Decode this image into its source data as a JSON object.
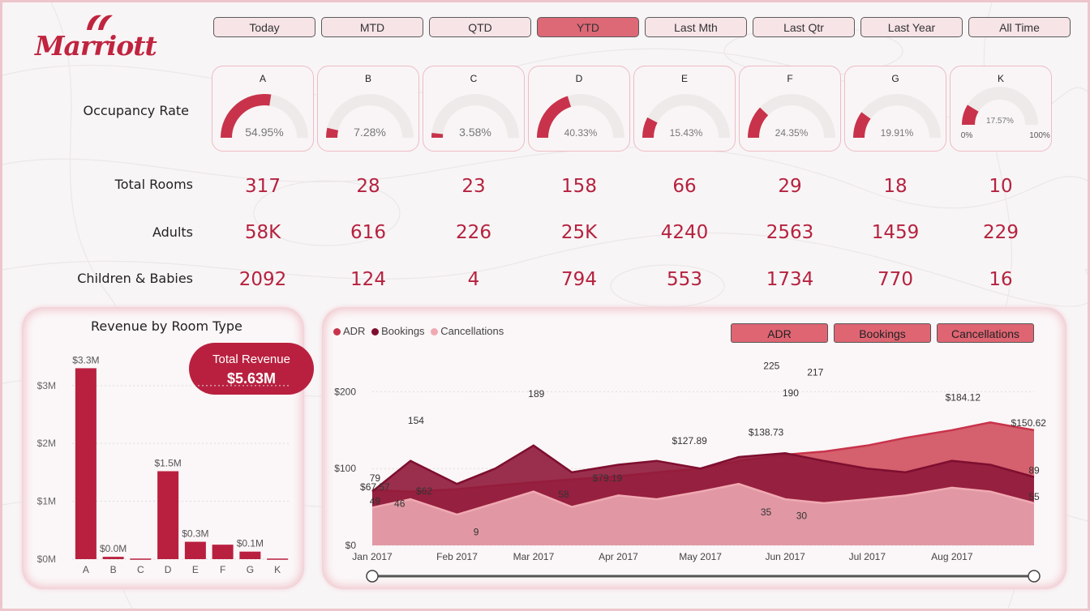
{
  "brand": {
    "logo_text": "Marriott",
    "color": "#c0243f"
  },
  "time_filters": [
    {
      "label": "Today",
      "active": false
    },
    {
      "label": "MTD",
      "active": false
    },
    {
      "label": "QTD",
      "active": false
    },
    {
      "label": "YTD",
      "active": true
    },
    {
      "label": "Last Mth",
      "active": false
    },
    {
      "label": "Last Qtr",
      "active": false
    },
    {
      "label": "Last Year",
      "active": false
    },
    {
      "label": "All Time",
      "active": false
    }
  ],
  "row_labels": {
    "occupancy": "Occupancy Rate",
    "rooms": "Total Rooms",
    "adults": "Adults",
    "children": "Children & Babies"
  },
  "hotels": [
    {
      "name": "A",
      "occupancy": 54.95,
      "occupancy_label": "54.95%",
      "rooms": "317",
      "adults": "58K",
      "children": "2092"
    },
    {
      "name": "B",
      "occupancy": 7.28,
      "occupancy_label": "7.28%",
      "rooms": "28",
      "adults": "616",
      "children": "124"
    },
    {
      "name": "C",
      "occupancy": 3.58,
      "occupancy_label": "3.58%",
      "rooms": "23",
      "adults": "226",
      "children": "4"
    },
    {
      "name": "D",
      "occupancy": 40.33,
      "occupancy_label": "40.33%",
      "rooms": "158",
      "adults": "25K",
      "children": "794"
    },
    {
      "name": "E",
      "occupancy": 15.43,
      "occupancy_label": "15.43%",
      "rooms": "66",
      "adults": "4240",
      "children": "553"
    },
    {
      "name": "F",
      "occupancy": 24.35,
      "occupancy_label": "24.35%",
      "rooms": "29",
      "adults": "2563",
      "children": "1734"
    },
    {
      "name": "G",
      "occupancy": 19.91,
      "occupancy_label": "19.91%",
      "rooms": "18",
      "adults": "1459",
      "children": "770"
    },
    {
      "name": "K",
      "occupancy": 17.57,
      "occupancy_label": "17.57%",
      "rooms": "10",
      "adults": "229",
      "children": "16"
    }
  ],
  "gauge_range": {
    "min_label": "0%",
    "max_label": "100%"
  },
  "colors": {
    "accent": "#c8334b",
    "bar": "#b9203f",
    "gauge_track": "#eeeae9",
    "adr": "#c8334b",
    "bookings": "#7e0e2f",
    "cancellations": "#f0a9b2",
    "active_filter": "#dd6876"
  },
  "revenue_panel": {
    "title": "Revenue by Room Type",
    "total_label": "Total Revenue",
    "total_value": "$5.63M"
  },
  "trend_panel": {
    "buttons": [
      "ADR",
      "Bookings",
      "Cancellations"
    ]
  },
  "chart_data": [
    {
      "type": "bar",
      "title": "Revenue by Room Type",
      "categories": [
        "A",
        "B",
        "C",
        "D",
        "E",
        "F",
        "G",
        "K"
      ],
      "values": [
        3.3,
        0.04,
        0.01,
        1.52,
        0.3,
        0.25,
        0.13,
        0.01
      ],
      "unit": "$M",
      "data_labels": [
        "$3.3M",
        "$0.0M",
        "",
        "$1.5M",
        "$0.3M",
        "",
        "$0.1M",
        ""
      ],
      "y_ticks": [
        "$0M",
        "$1M",
        "$2M",
        "$3M"
      ],
      "ylim": [
        0,
        3.6
      ],
      "grid": true
    },
    {
      "type": "area",
      "legend": [
        "ADR",
        "Bookings",
        "Cancellations"
      ],
      "legend_position": "top-left",
      "x_ticks": [
        "Jan 2017",
        "Feb 2017",
        "Mar 2017",
        "Apr 2017",
        "May 2017",
        "Jun 2017",
        "Jul 2017",
        "Aug 2017"
      ],
      "x_range": [
        "2017-01-01",
        "2017-08-31"
      ],
      "y_ticks": [
        "$0",
        "$100",
        "$200"
      ],
      "ylim": [
        0,
        250
      ],
      "series": [
        {
          "name": "ADR",
          "x": [
            "2017-01-01",
            "2017-01-15",
            "2017-02-01",
            "2017-02-15",
            "2017-03-01",
            "2017-03-15",
            "2017-04-01",
            "2017-04-15",
            "2017-05-01",
            "2017-05-15",
            "2017-06-01",
            "2017-06-15",
            "2017-07-01",
            "2017-07-15",
            "2017-08-01",
            "2017-08-15",
            "2017-08-31"
          ],
          "values": [
            72,
            70,
            73,
            78,
            82,
            86,
            90,
            95,
            100,
            110,
            118,
            122,
            130,
            140,
            150,
            160,
            150
          ]
        },
        {
          "name": "Bookings",
          "x": [
            "2017-01-01",
            "2017-01-15",
            "2017-02-01",
            "2017-02-15",
            "2017-03-01",
            "2017-03-15",
            "2017-04-01",
            "2017-04-15",
            "2017-05-01",
            "2017-05-15",
            "2017-06-01",
            "2017-06-15",
            "2017-07-01",
            "2017-07-15",
            "2017-08-01",
            "2017-08-15",
            "2017-08-31"
          ],
          "values": [
            70,
            110,
            80,
            100,
            130,
            95,
            105,
            110,
            100,
            115,
            120,
            110,
            100,
            95,
            110,
            105,
            89
          ]
        },
        {
          "name": "Cancellations",
          "x": [
            "2017-01-01",
            "2017-01-15",
            "2017-02-01",
            "2017-02-15",
            "2017-03-01",
            "2017-03-15",
            "2017-04-01",
            "2017-04-15",
            "2017-05-01",
            "2017-05-15",
            "2017-06-01",
            "2017-06-15",
            "2017-07-01",
            "2017-07-15",
            "2017-08-01",
            "2017-08-15",
            "2017-08-31"
          ],
          "values": [
            49,
            60,
            40,
            55,
            70,
            50,
            65,
            60,
            70,
            80,
            60,
            55,
            60,
            65,
            75,
            70,
            55
          ]
        }
      ],
      "annotations": [
        {
          "x": "2017-01-02",
          "y": 79,
          "text": "79"
        },
        {
          "x": "2017-01-02",
          "y": 67.57,
          "text": "$67.57"
        },
        {
          "x": "2017-01-02",
          "y": 49,
          "text": "49"
        },
        {
          "x": "2017-01-11",
          "y": 46,
          "text": "46"
        },
        {
          "x": "2017-01-17",
          "y": 154,
          "text": "154"
        },
        {
          "x": "2017-01-20",
          "y": 62,
          "text": "$62"
        },
        {
          "x": "2017-02-08",
          "y": 9,
          "text": "9"
        },
        {
          "x": "2017-03-02",
          "y": 189,
          "text": "189"
        },
        {
          "x": "2017-03-12",
          "y": 58,
          "text": "58"
        },
        {
          "x": "2017-03-28",
          "y": 79.19,
          "text": "$79.19"
        },
        {
          "x": "2017-04-27",
          "y": 127.89,
          "text": "$127.89"
        },
        {
          "x": "2017-05-25",
          "y": 35,
          "text": "35"
        },
        {
          "x": "2017-05-25",
          "y": 138.73,
          "text": "$138.73"
        },
        {
          "x": "2017-05-27",
          "y": 225,
          "text": "225"
        },
        {
          "x": "2017-06-03",
          "y": 190,
          "text": "190"
        },
        {
          "x": "2017-06-12",
          "y": 217,
          "text": "217"
        },
        {
          "x": "2017-06-07",
          "y": 30,
          "text": "30"
        },
        {
          "x": "2017-08-05",
          "y": 184.12,
          "text": "$184.12"
        },
        {
          "x": "2017-08-29",
          "y": 150.62,
          "text": "$150.62"
        },
        {
          "x": "2017-08-31",
          "y": 89,
          "text": "89"
        },
        {
          "x": "2017-08-31",
          "y": 55,
          "text": "55"
        }
      ],
      "grid": true
    }
  ]
}
